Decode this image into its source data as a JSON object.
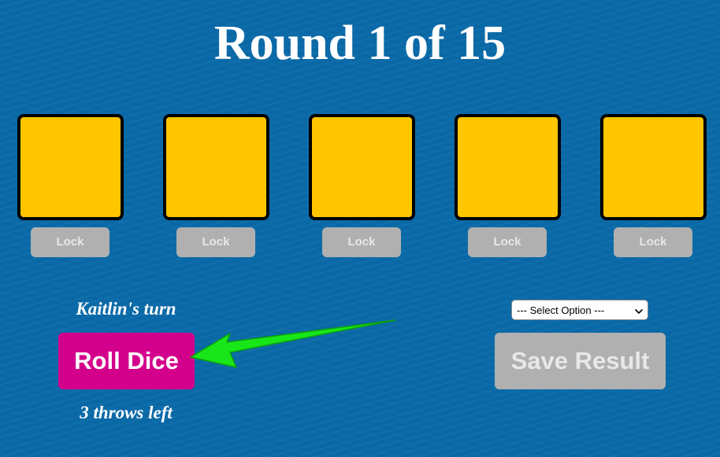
{
  "header": {
    "title": "Round 1 of 15"
  },
  "dice": [
    {
      "lock_label": "Lock"
    },
    {
      "lock_label": "Lock"
    },
    {
      "lock_label": "Lock"
    },
    {
      "lock_label": "Lock"
    },
    {
      "lock_label": "Lock"
    }
  ],
  "player": {
    "turn_text": "Kaitlin's turn",
    "throws_text": "3 throws left"
  },
  "controls": {
    "roll_label": "Roll Dice",
    "save_label": "Save Result",
    "select_value": "--- Select Option ---"
  },
  "colors": {
    "background": "#0a6aa8",
    "die_fill": "#ffc600",
    "roll_button": "#d3008c",
    "disabled_button": "#b0b0b0",
    "arrow": "#19e619"
  },
  "icons": {
    "arrow": "pointer-arrow",
    "select": "chevron-down-icon"
  }
}
